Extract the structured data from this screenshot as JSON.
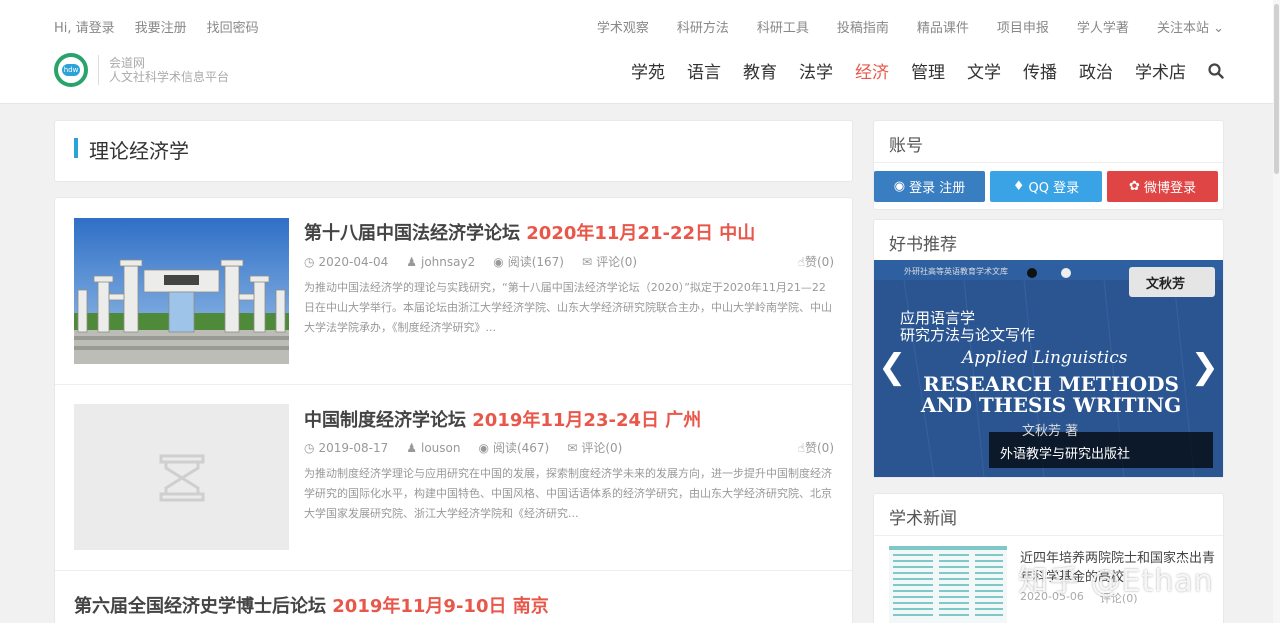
{
  "topbar": {
    "left_links": [
      "Hi, 请登录",
      "我要注册",
      "找回密码"
    ],
    "right_links": [
      "学术观察",
      "科研方法",
      "科研工具",
      "投稿指南",
      "精品课件",
      "项目申报",
      "学人学著",
      "关注本站"
    ]
  },
  "logo": {
    "mark_text": "hdw",
    "line1": "会道网",
    "line2": "人文社科学术信息平台"
  },
  "nav": {
    "items": [
      "学苑",
      "语言",
      "教育",
      "法学",
      "经济",
      "管理",
      "文学",
      "传播",
      "政治",
      "学术店"
    ],
    "active": "经济"
  },
  "category": {
    "title": "理论经济学"
  },
  "posts": [
    {
      "title": "第十八届中国法经济学论坛",
      "title_highlight": "2020年11月21-22日 中山",
      "date": "2020-04-04",
      "author": "johnsay2",
      "views": "阅读(167)",
      "comments": "评论(0)",
      "likes": "赞(0)",
      "excerpt": "为推动中国法经济学的理论与实践研究，“第十八届中国法经济学论坛（2020）”拟定于2020年11月21—22日在中山大学举行。本届论坛由浙江大学经济学院、山东大学经济研究院联合主办，中山大学岭南学院、中山大学法学院承办，《制度经济学研究》..."
    },
    {
      "title": "中国制度经济学论坛",
      "title_highlight": "2019年11月23-24日 广州",
      "date": "2019-08-17",
      "author": "louson",
      "views": "阅读(467)",
      "comments": "评论(0)",
      "likes": "赞(0)",
      "excerpt": "为推动制度经济学理论与应用研究在中国的发展，探索制度经济学未来的发展方向，进一步提升中国制度经济学研究的国际化水平，构建中国特色、中国风格、中国话语体系的经济学研究，由山东大学经济研究院、北京大学国家发展研究院、浙江大学经济学院和《经济研究..."
    },
    {
      "title": "第六届全国经济史学博士后论坛",
      "title_highlight": "2019年11月9-10日 南京"
    }
  ],
  "sidebar": {
    "account": {
      "title": "账号",
      "login_label": "登录 注册",
      "qq_label": "QQ 登录",
      "weibo_label": "微博登录"
    },
    "books": {
      "title": "好书推荐",
      "author": "文秋芳",
      "cover_cn": "应用语言学\n研究方法与论文写作",
      "cover_en_script": "Applied Linguistics",
      "cover_en_main": "RESEARCH METHODS\nAND THESIS WRITING",
      "cover_top": "外研社高等英语教育学术文库",
      "cover_overlay_author": "文秋芳 著",
      "caption": "外语教学与研究出版社"
    },
    "news": {
      "title": "学术新闻",
      "item_title": "近四年培养两院院士和国家杰出青年科学基金的高校",
      "item_date": "2020-05-06",
      "item_comments": "评论(0)"
    }
  },
  "watermark": "知乎 @Ethan"
}
